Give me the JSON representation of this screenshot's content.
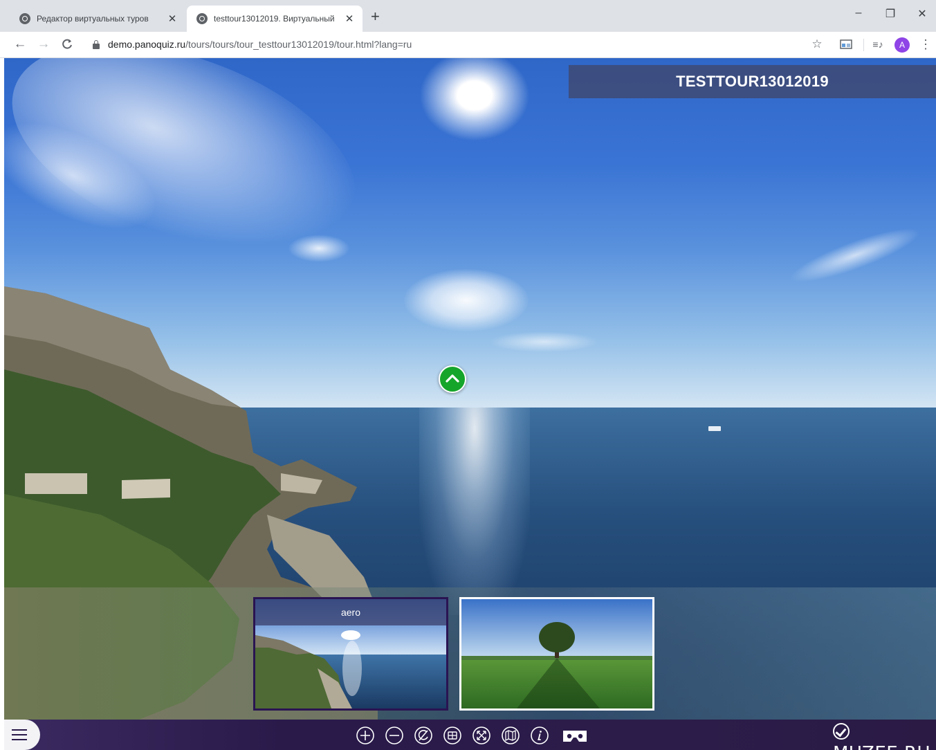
{
  "browser": {
    "tabs": [
      {
        "title": "Редактор виртуальных туров",
        "close": "✕"
      },
      {
        "title": "testtour13012019. Виртуальный",
        "close": "✕"
      }
    ],
    "new_tab": "+",
    "window_controls": {
      "minimize": "–",
      "restore": "❐",
      "close": "✕"
    },
    "nav": {
      "back": "←",
      "forward": "→",
      "reload": "C"
    },
    "url": {
      "host": "demo.panoquiz.ru",
      "path": "/tours/tours/tour_testtour13012019/tour.html?lang=ru"
    },
    "toolbar_icons": {
      "bookmark": "☆",
      "media": "≡♪",
      "menu": "⋮"
    },
    "profile_initial": "A"
  },
  "tour": {
    "title": "TESTTOUR13012019",
    "thumbnails": [
      {
        "label": "aero",
        "active": true
      },
      {
        "label": "",
        "active": false
      }
    ],
    "controls": [
      "zoom-in-icon",
      "zoom-out-icon",
      "autorotate-icon",
      "thumbnails-icon",
      "fullscreen-icon",
      "map-icon",
      "info-icon",
      "vr-icon"
    ],
    "brand": "MUZEE.RU"
  },
  "colors": {
    "hotspot": "#15a52a",
    "title_bg": "#404870",
    "control_bar": "#2a1a4a",
    "active_thumb_border": "#2a1452"
  }
}
